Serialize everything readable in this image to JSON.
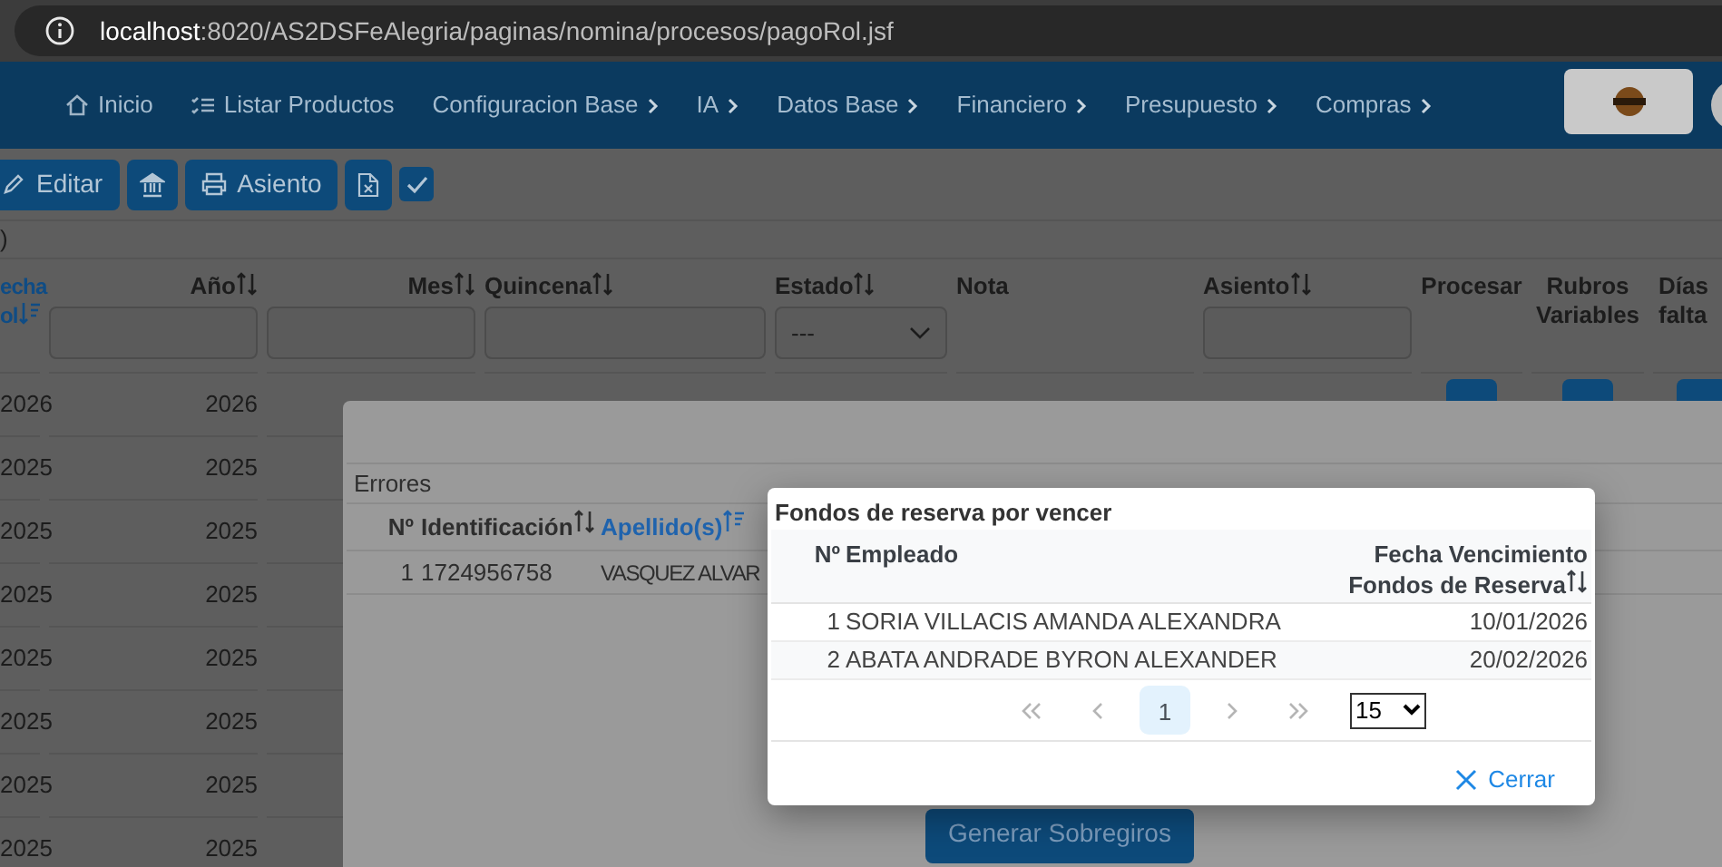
{
  "browser": {
    "url_host": "localhost",
    "url_path": ":8020/AS2DSFeAlegria/paginas/nomina/procesos/pagoRol.jsf"
  },
  "nav": {
    "items": [
      {
        "kind": "home",
        "label": "Inicio"
      },
      {
        "kind": "list",
        "label": "Listar Productos"
      },
      {
        "kind": "menu",
        "label": "Configuracion Base"
      },
      {
        "kind": "menu",
        "label": "IA"
      },
      {
        "kind": "menu",
        "label": "Datos Base"
      },
      {
        "kind": "menu",
        "label": "Financiero"
      },
      {
        "kind": "menu",
        "label": "Presupuesto"
      },
      {
        "kind": "menu",
        "label": "Compras"
      }
    ]
  },
  "toolbar": {
    "buttons": [
      {
        "kind": "edit",
        "label": "Editar"
      },
      {
        "kind": "bank"
      },
      {
        "kind": "print",
        "label": "Asiento"
      },
      {
        "kind": "excel"
      }
    ],
    "checkbox": {
      "checked": true
    }
  },
  "section_label": ")",
  "table": {
    "columns": [
      {
        "lines": [
          "echa",
          "ol"
        ],
        "sort": {
          "kind": "desc"
        }
      },
      {
        "lines": [
          "Año"
        ],
        "sort": {
          "kind": "none"
        },
        "filter": {
          "kind": "text"
        }
      },
      {
        "lines": [
          "Mes"
        ],
        "sort": {
          "kind": "none"
        },
        "filter": {
          "kind": "text"
        }
      },
      {
        "lines": [
          "Quincena"
        ],
        "sort": {
          "kind": "none"
        },
        "filter": {
          "kind": "text"
        }
      },
      {
        "lines": [
          "Estado"
        ],
        "sort": {
          "kind": "none"
        },
        "filter": {
          "kind": "select",
          "value": "---"
        }
      },
      {
        "lines": [
          "Nota"
        ]
      },
      {
        "lines": [
          "Asiento"
        ],
        "sort": {
          "kind": "none"
        },
        "filter": {
          "kind": "text"
        }
      },
      {
        "lines": [
          "Procesar"
        ]
      },
      {
        "lines": [
          "Rubros",
          "Variables"
        ]
      },
      {
        "lines": [
          "Días",
          "falta"
        ]
      }
    ],
    "rows": [
      {
        "cells": [
          "2026",
          "2026"
        ],
        "actions": true
      },
      {
        "cells": [
          "2025",
          "2025"
        ],
        "actions": false
      },
      {
        "cells": [
          "2025",
          "2025"
        ],
        "actions": false
      },
      {
        "cells": [
          "2025",
          "2025"
        ],
        "actions": false
      },
      {
        "cells": [
          "2025",
          "2025"
        ],
        "actions": false
      },
      {
        "cells": [
          "2025",
          "2025"
        ],
        "actions": false
      },
      {
        "cells": [
          "2025",
          "2025"
        ],
        "actions": false
      },
      {
        "cells": [
          "2025",
          "2025"
        ],
        "actions": false
      }
    ]
  },
  "errors_dialog": {
    "section_title": "Errores",
    "columns": [
      {
        "label": "Nº"
      },
      {
        "label": "Identificación",
        "sort": {
          "kind": "none"
        }
      },
      {
        "label": "Apellido(s)",
        "sort": {
          "kind": "asc"
        }
      }
    ],
    "rows": [
      [
        "1",
        "1724956758",
        "VASQUEZ ALVAR"
      ]
    ],
    "button": "Generar Sobregiros"
  },
  "reserve_dialog": {
    "title": "Fondos de reserva por vencer",
    "columns": [
      {
        "lines": [
          "Nº"
        ]
      },
      {
        "lines": [
          "Empleado"
        ]
      },
      {
        "lines": [
          "Fecha Vencimiento",
          "Fondos de Reserva"
        ],
        "sort": {
          "kind": "none"
        }
      }
    ],
    "rows": [
      [
        "1",
        "SORIA VILLACIS AMANDA ALEXANDRA",
        "10/01/2026"
      ],
      [
        "2",
        "ABATA ANDRADE BYRON ALEXANDER",
        "20/02/2026"
      ]
    ],
    "paginator": {
      "pages": [
        {
          "label": "1",
          "selected": true
        }
      ],
      "page_size": "15"
    },
    "close_button": "Cerrar"
  }
}
